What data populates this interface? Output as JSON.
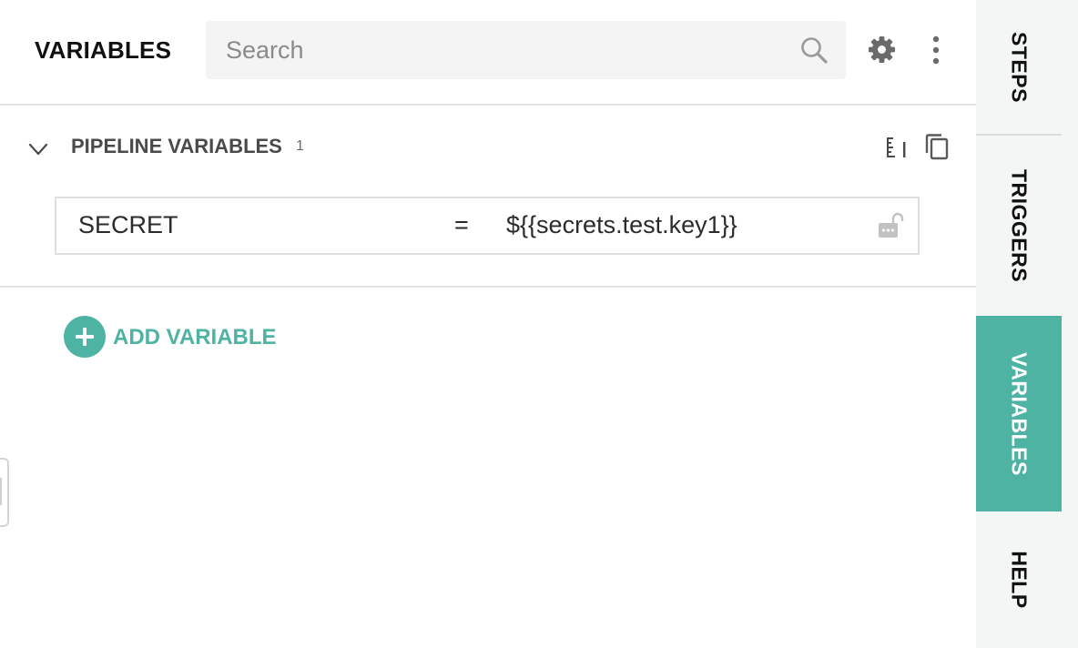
{
  "header": {
    "title": "VARIABLES",
    "search_placeholder": "Search",
    "search_value": ""
  },
  "section": {
    "title": "PIPELINE VARIABLES",
    "count": "1",
    "variables": [
      {
        "name": "SECRET",
        "operator": "=",
        "value": "${{secrets.test.key1}}"
      }
    ]
  },
  "add_variable": {
    "icon": "plus-icon",
    "label": "ADD VARIABLE"
  },
  "rail": {
    "tabs": [
      {
        "label": "STEPS",
        "active": false
      },
      {
        "label": "TRIGGERS",
        "active": false
      },
      {
        "label": "VARIABLES",
        "active": true
      },
      {
        "label": "HELP",
        "active": false
      }
    ]
  },
  "colors": {
    "accent": "#4fb3a4",
    "rail_background": "#f4f6f5",
    "search_background": "#f4f4f4",
    "divider": "#e2e2e2"
  },
  "icons": {
    "search": "search-icon",
    "settings": "gear-icon",
    "more": "more-vertical-icon",
    "collapse": "chevron-down-icon",
    "sort": "sort-icon",
    "copy": "copy-icon",
    "lock": "unlocked-lock-icon"
  }
}
